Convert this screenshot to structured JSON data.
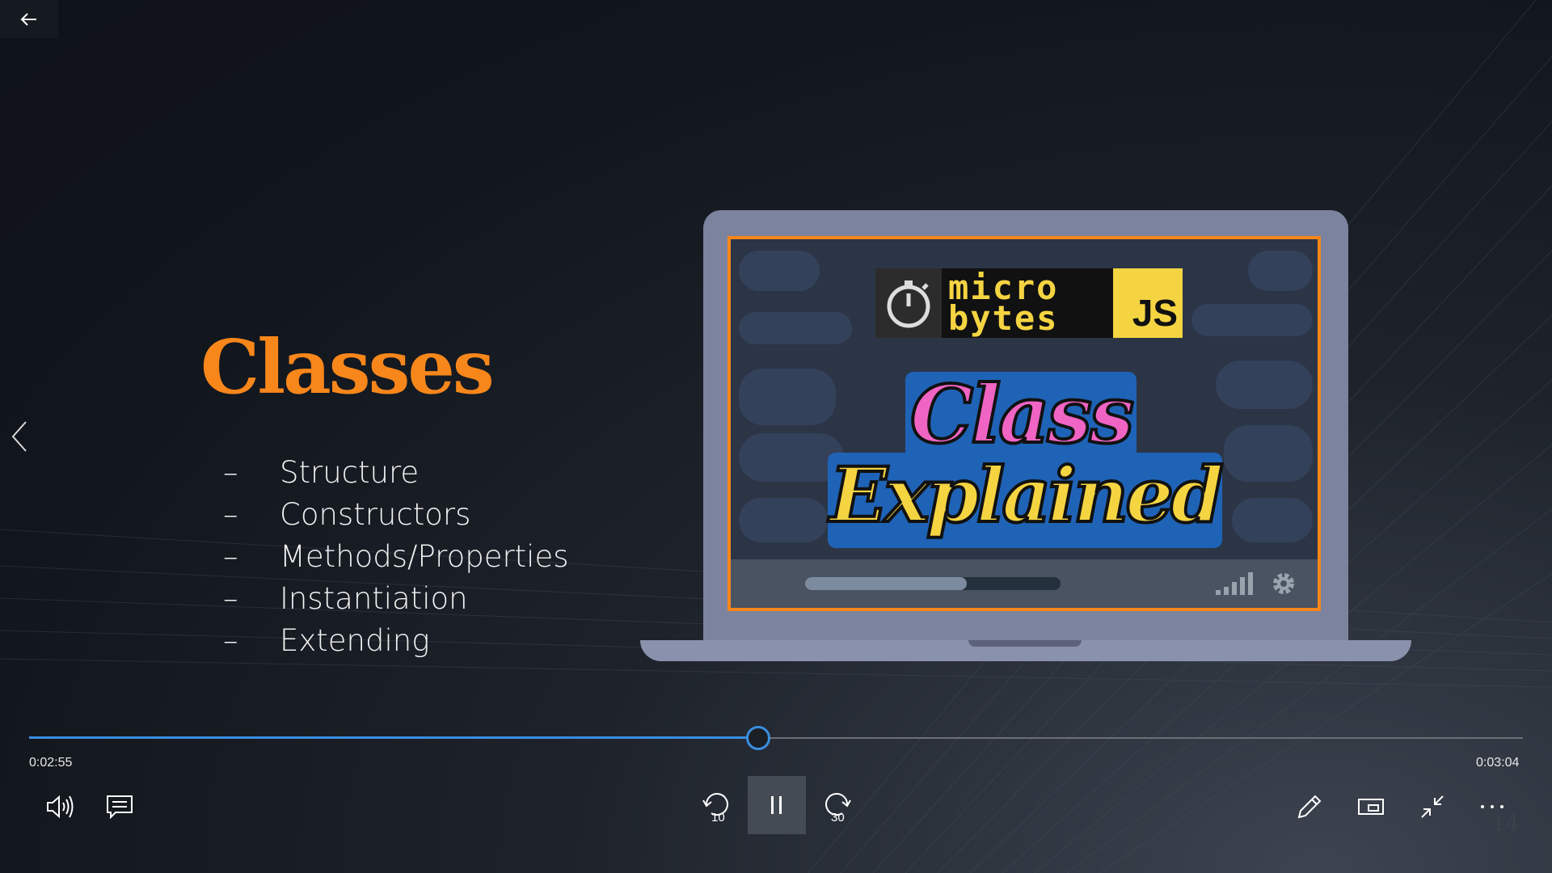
{
  "slide": {
    "title": "Classes",
    "bullet_marker": "–",
    "bullets": [
      "Structure",
      "Constructors",
      "Methods/Properties",
      "Instantiation",
      "Extending"
    ],
    "page_number": "14"
  },
  "thumbnail": {
    "logo_line1": "micro",
    "logo_line2": "bytes",
    "logo_js": "JS",
    "headline_1": "Class",
    "headline_2": "Explained"
  },
  "player": {
    "current_time": "0:02:55",
    "total_time": "0:03:04",
    "progress_fraction": 0.487,
    "accent_color": "#3a8ee0",
    "icons": {
      "back": "back-arrow-icon",
      "prev": "chevron-left-icon",
      "volume": "volume-icon",
      "captions": "captions-icon",
      "skip_back": "skip-back-10-icon",
      "pause": "pause-icon",
      "skip_forward": "skip-forward-30-icon",
      "pen": "pen-icon",
      "mini_view": "mini-view-icon",
      "exit_fullscreen": "exit-fullscreen-icon",
      "more": "more-icon"
    },
    "skip_back_label": "10",
    "skip_forward_label": "30"
  }
}
